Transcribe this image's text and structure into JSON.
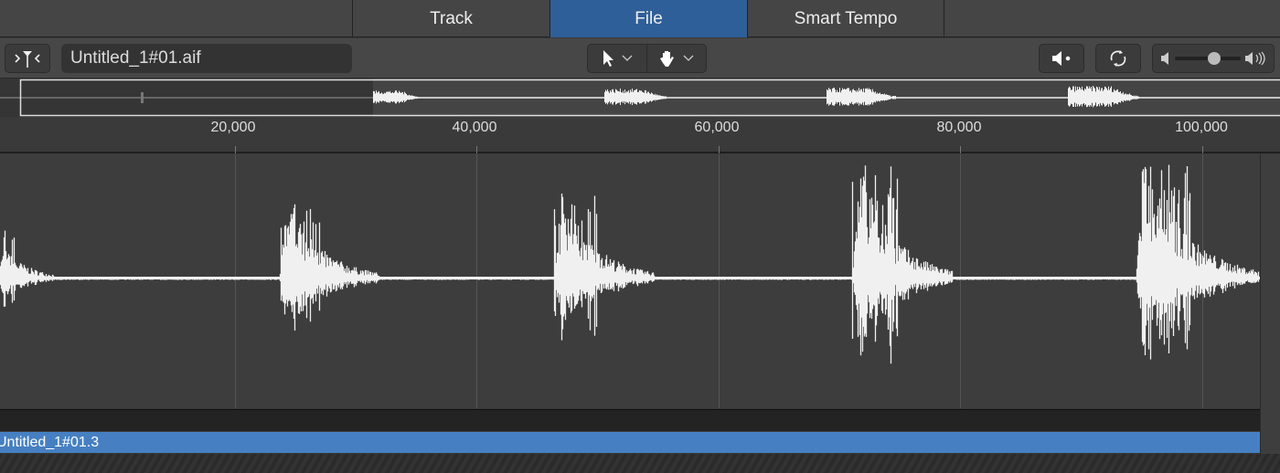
{
  "tabs": [
    {
      "label": "Track"
    },
    {
      "label": "File",
      "active": true
    },
    {
      "label": "Smart Tempo"
    }
  ],
  "toolbar": {
    "filename": "Untitled_1#01.aif",
    "catch_icon": "catch-playhead-icon",
    "pointer_tool": "pointer-icon",
    "hand_tool": "hand-icon",
    "speaker_icon": "speaker-preview-icon",
    "cycle_icon": "cycle-icon",
    "volume_level": 0.6
  },
  "ruler": {
    "ticks": [
      "20,000",
      "40,000",
      "60,000",
      "80,000",
      "100,000"
    ]
  },
  "region": {
    "name": "Untitled_1#01.3"
  },
  "colors": {
    "accent": "#2f5f98",
    "region": "#4680c2",
    "waveform": "#f0f0f0"
  }
}
